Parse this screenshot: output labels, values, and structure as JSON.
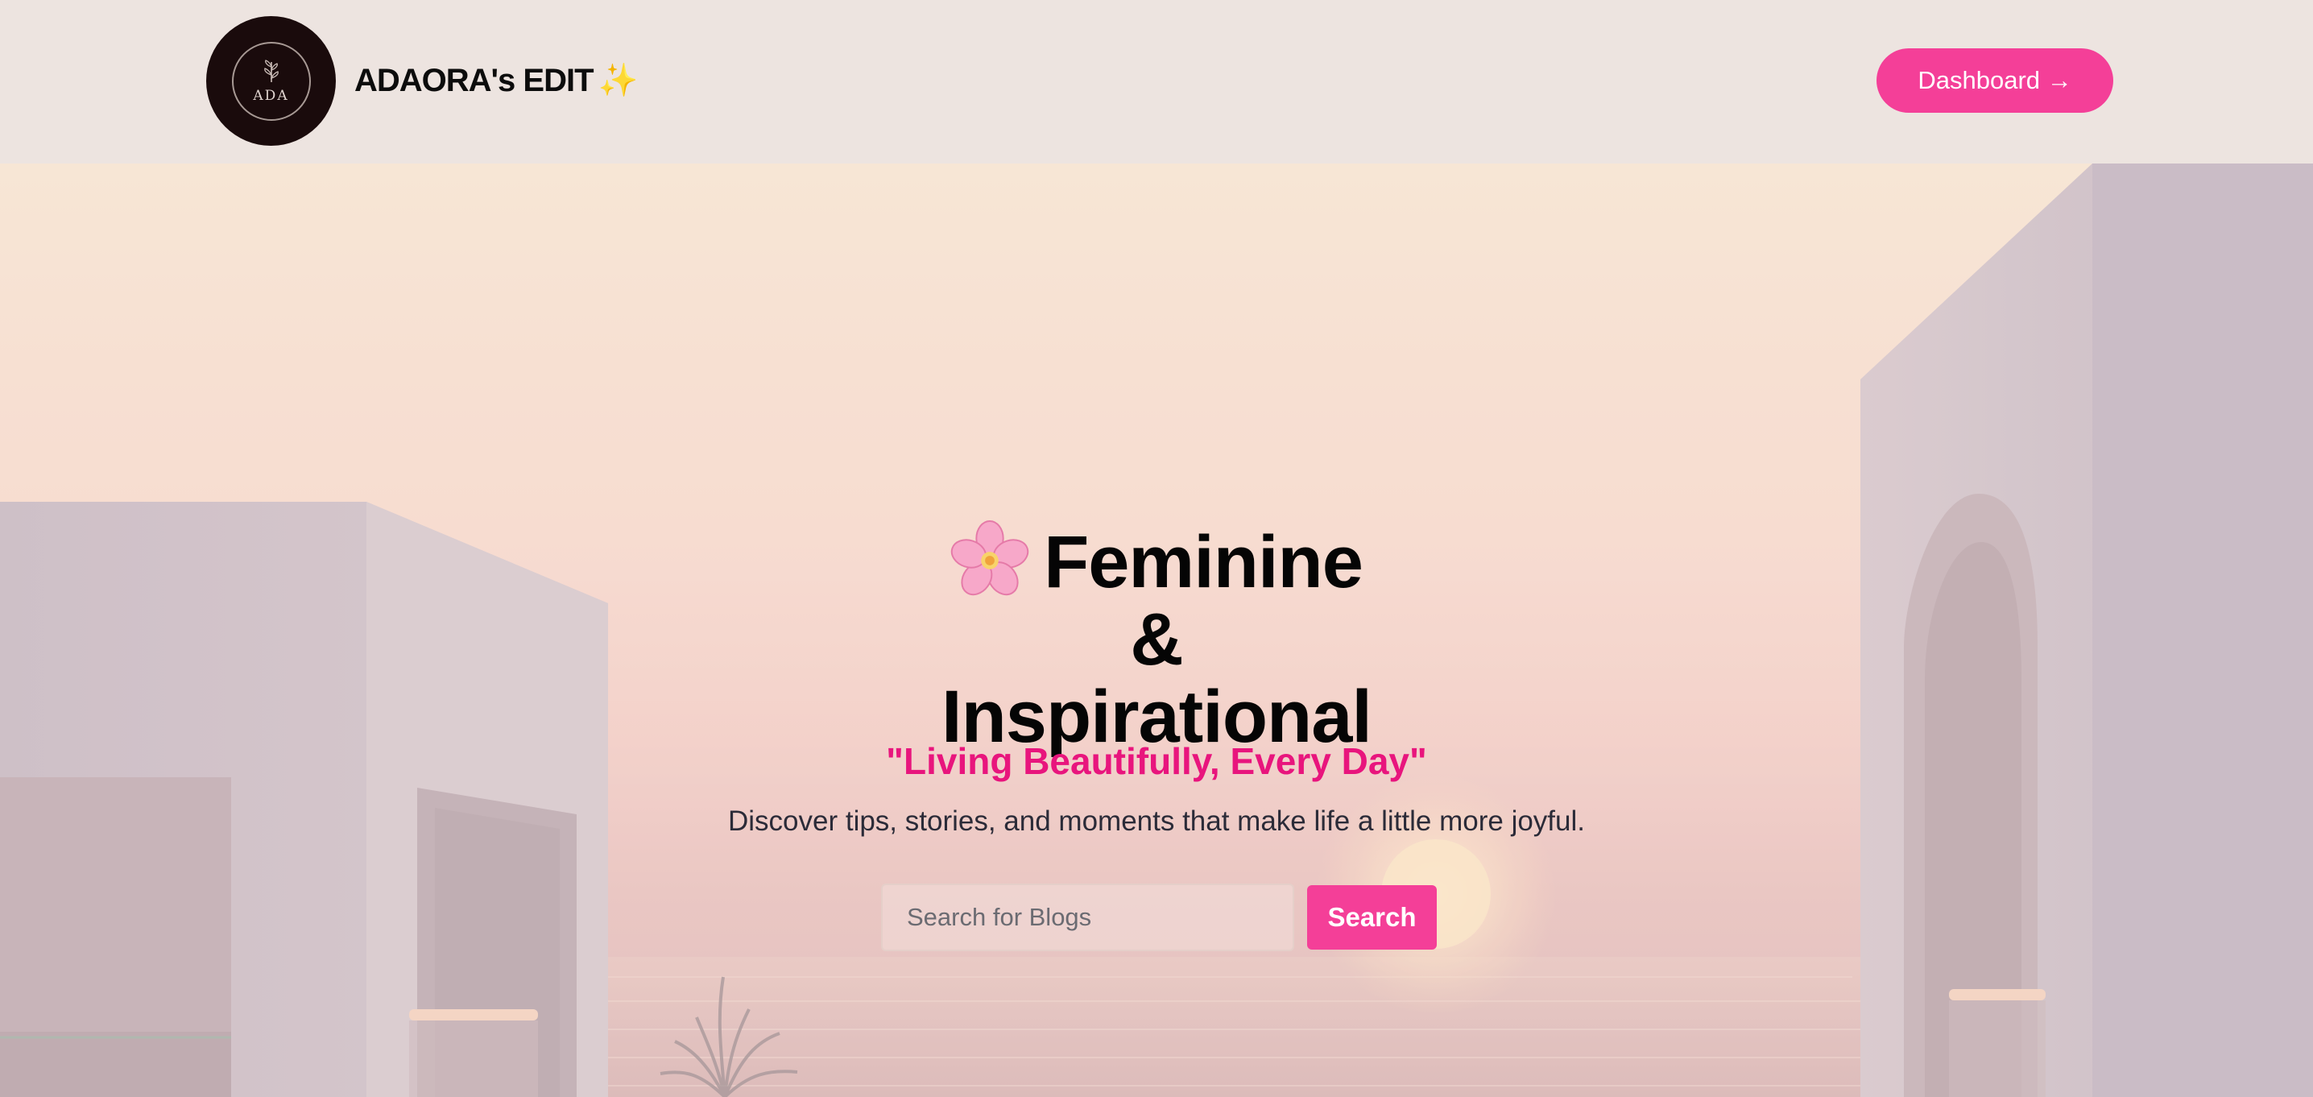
{
  "header": {
    "logo_text": "ADA",
    "brand_name": "ADAORA's EDIT",
    "brand_sparkle": "✨",
    "dashboard_label": "Dashboard →"
  },
  "hero": {
    "title_line_1": "Feminine",
    "title_line_2": "&",
    "title_line_3": "Inspirational",
    "title_icon": "cherry-blossom-icon",
    "tagline": "\"Living Beautifully, Every Day\"",
    "subtitle": "Discover tips, stories, and moments that make life a little more joyful.",
    "search_placeholder": "Search for Blogs",
    "search_value": "",
    "search_button_label": "Search"
  },
  "colors": {
    "accent_pink": "#f43f98",
    "tagline_pink": "#e8157d",
    "header_bg": "#ede4e0",
    "logo_bg": "#1a0b0c"
  }
}
